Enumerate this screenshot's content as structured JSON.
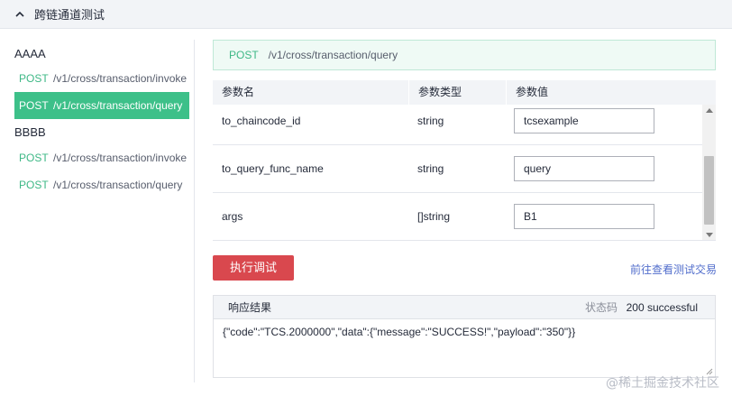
{
  "header": {
    "title": "跨链通道测试",
    "collapse_icon": "chevron-up-icon"
  },
  "sidebar": {
    "groups": [
      {
        "label": "AAAA",
        "items": [
          {
            "method": "POST",
            "path": "/v1/cross/transaction/invoke",
            "active": false
          }
        ]
      },
      {
        "label": "",
        "items": [
          {
            "method": "POST",
            "path": "/v1/cross/transaction/query",
            "active": true
          }
        ]
      },
      {
        "label": "BBBB",
        "items": [
          {
            "method": "POST",
            "path": "/v1/cross/transaction/invoke",
            "active": false
          },
          {
            "method": "POST",
            "path": "/v1/cross/transaction/query",
            "active": false
          }
        ]
      }
    ]
  },
  "endpoint": {
    "method": "POST",
    "path": "/v1/cross/transaction/query"
  },
  "params_table": {
    "headers": [
      "参数名",
      "参数类型",
      "参数值"
    ],
    "rows": [
      {
        "name": "to_chaincode_id",
        "type": "string",
        "value": "tcsexample"
      },
      {
        "name": "to_query_func_name",
        "type": "string",
        "value": "query"
      },
      {
        "name": "args",
        "type": "[]string",
        "value": "B1"
      }
    ]
  },
  "actions": {
    "execute_label": "执行调试",
    "goto_link": "前往查看测试交易"
  },
  "result": {
    "title": "响应结果",
    "status_label": "状态码",
    "status_value": "200  successful",
    "body": "{\"code\":\"TCS.2000000\",\"data\":{\"message\":\"SUCCESS!\",\"payload\":\"350\"}}"
  },
  "watermark": "@稀土掘金技术社区",
  "colors": {
    "accent_green": "#3dc089",
    "danger_red": "#d9484e",
    "link_blue": "#526ecc",
    "header_bg": "#f2f4f7"
  }
}
